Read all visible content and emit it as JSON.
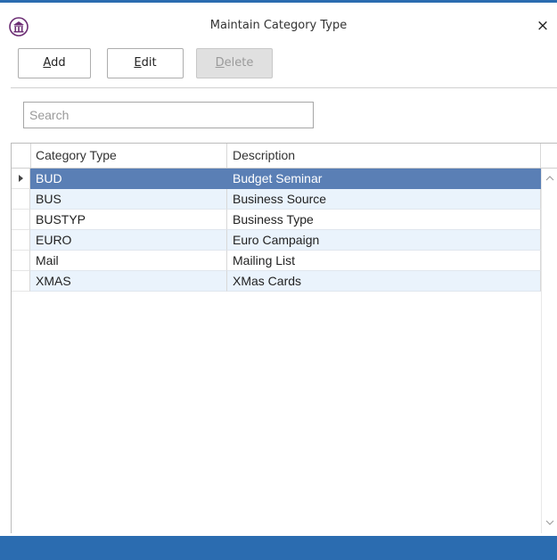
{
  "window": {
    "title": "Maintain Category Type",
    "close_glyph": "×"
  },
  "toolbar": {
    "add": {
      "mnemonic": "A",
      "rest": "dd"
    },
    "edit": {
      "mnemonic": "E",
      "rest": "dit"
    },
    "delete": {
      "mnemonic": "D",
      "rest": "elete",
      "disabled": true
    }
  },
  "search": {
    "placeholder": "Search",
    "value": ""
  },
  "grid": {
    "columns": [
      "Category Type",
      "Description"
    ],
    "rows": [
      {
        "type": "BUD",
        "description": "Budget Seminar"
      },
      {
        "type": "BUS",
        "description": "Business Source"
      },
      {
        "type": "BUSTYP",
        "description": "Business Type"
      },
      {
        "type": "EURO",
        "description": "Euro Campaign"
      },
      {
        "type": "Mail",
        "description": "Mailing List"
      },
      {
        "type": "XMAS",
        "description": "XMas Cards"
      }
    ],
    "selected_row": 0
  },
  "colors": {
    "accent": "#2b6cb0",
    "selected_row": "#5a7fb5",
    "alt_row": "#eaf3fc"
  },
  "icons": {
    "app": "museum-building-icon",
    "close": "close-icon",
    "row_pointer": "row-selector-arrow-icon",
    "scroll_up": "chevron-up-icon",
    "scroll_down": "chevron-down-icon"
  }
}
